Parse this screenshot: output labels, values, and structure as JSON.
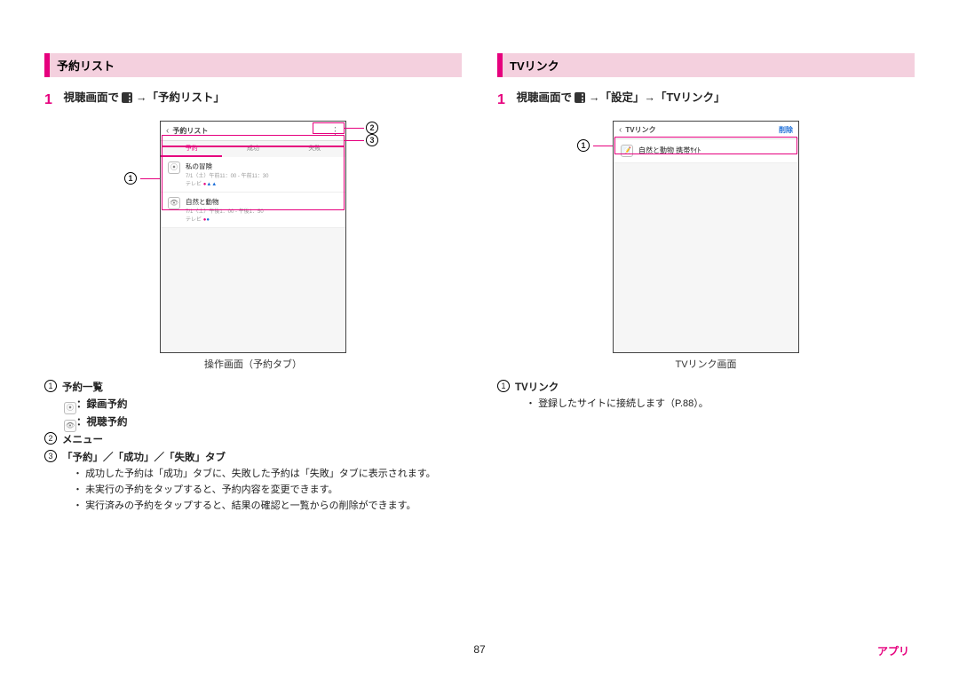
{
  "left": {
    "section_title": "予約リスト",
    "step1": "視聴画面で",
    "step1_tail": " →「予約リスト」",
    "phone": {
      "header_title": "予約リスト",
      "tabs": [
        "予約",
        "成功",
        "失敗"
      ],
      "items": [
        {
          "icon": "rec",
          "title": "私の冒険",
          "date": "7/1（土）午前11：00 - 午前11：30",
          "ch": "テレビ",
          "marks": "●▲▲"
        },
        {
          "icon": "view",
          "title": "自然と動物",
          "date": "7/1（土）午後1：00 - 午後1：50",
          "ch": "テレビ",
          "marks": "●●"
        }
      ]
    },
    "caption": "操作画面（予約タブ）",
    "notes": {
      "n1_label": "予約一覧",
      "n1_rec": "：録画予約",
      "n1_view": "：視聴予約",
      "n2_label": "メニュー",
      "n3_label": "「予約」／「成功」／「失敗」タブ",
      "bullets": [
        "成功した予約は「成功」タブに、失敗した予約は「失敗」タブに表示されます。",
        "未実行の予約をタップすると、予約内容を変更できます。",
        "実行済みの予約をタップすると、結果の確認と一覧からの削除ができます。"
      ]
    }
  },
  "right": {
    "section_title": "TVリンク",
    "step1": "視聴画面で",
    "step1_tail": " →「設定」→「TVリンク」",
    "phone": {
      "header_title": "TVリンク",
      "delete_label": "削除",
      "item_title": "自然と動物 携帯ｻｲﾄ"
    },
    "caption": "TVリンク画面",
    "notes": {
      "n1_label": "TVリンク",
      "bullet": "登録したサイトに接続します（P.88）。"
    }
  },
  "page_number": "87",
  "footer_app": "アプリ"
}
